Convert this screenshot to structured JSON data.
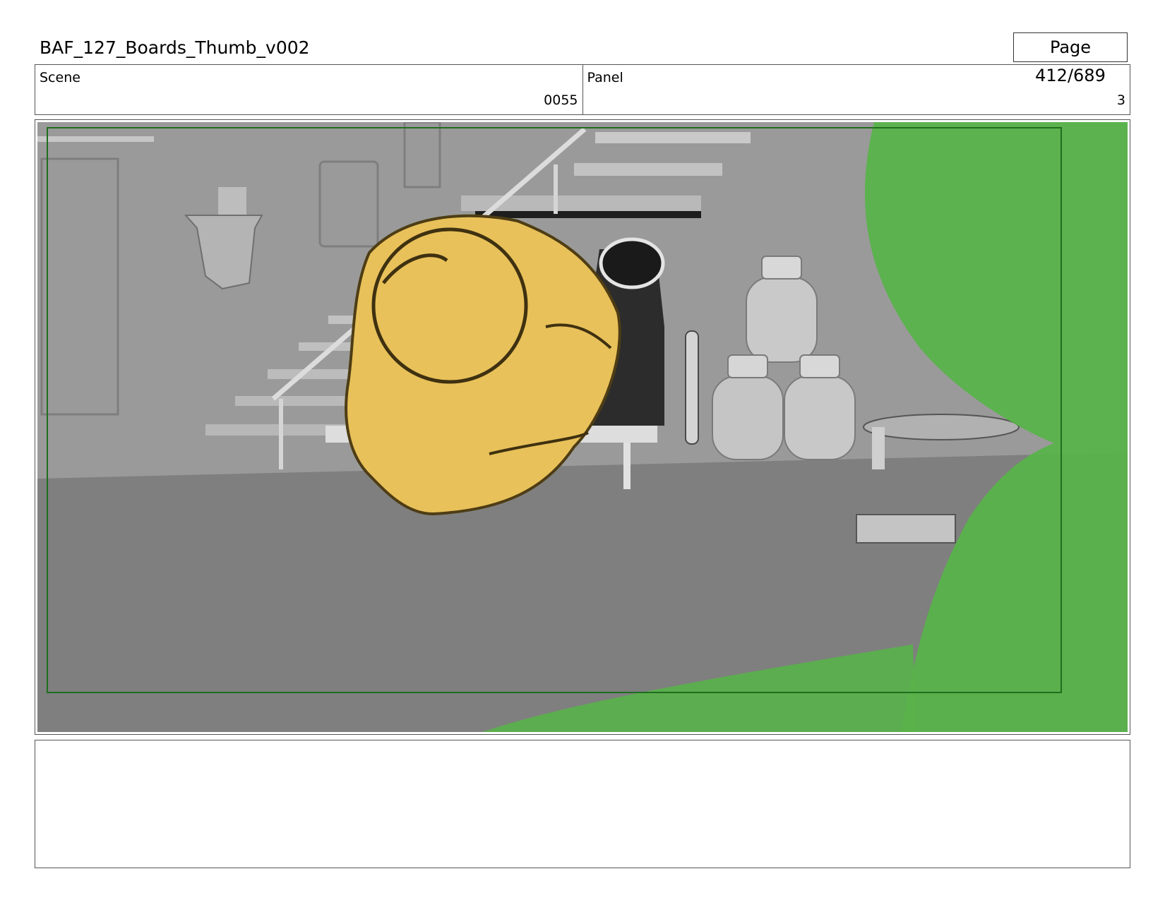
{
  "header": {
    "document_title": "BAF_127_Boards_Thumb_v002",
    "page_indicator": "Page 412/689"
  },
  "info": {
    "scene_label": "Scene",
    "scene_value": "0055",
    "panel_label": "Panel",
    "panel_value": "3"
  },
  "panel_image": {
    "colors": {
      "wall": "#9a9a9a",
      "floor": "#7f7f7f",
      "sketch_yellow": "#e8c15a",
      "sketch_green": "#59b34a",
      "safe_frame": "#1f6e1f"
    }
  },
  "notes": {
    "text": ""
  }
}
